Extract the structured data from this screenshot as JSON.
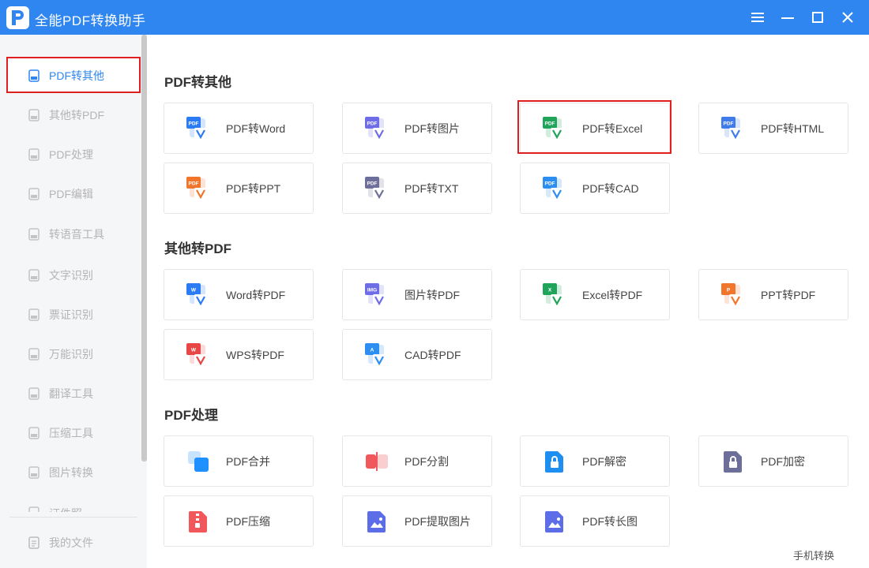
{
  "app": {
    "title": "全能PDF转换助手"
  },
  "sidebar": {
    "items": [
      {
        "label": "PDF转其他",
        "icon": "pdf-convert-icon",
        "active": true
      },
      {
        "label": "其他转PDF",
        "icon": "to-pdf-icon"
      },
      {
        "label": "PDF处理",
        "icon": "pdf-process-icon"
      },
      {
        "label": "PDF编辑",
        "icon": "pdf-edit-icon"
      },
      {
        "label": "转语音工具",
        "icon": "voice-icon"
      },
      {
        "label": "文字识别",
        "icon": "ocr-icon"
      },
      {
        "label": "票证识别",
        "icon": "ticket-icon"
      },
      {
        "label": "万能识别",
        "icon": "scan-icon"
      },
      {
        "label": "翻译工具",
        "icon": "translate-icon"
      },
      {
        "label": "压缩工具",
        "icon": "compress-icon"
      },
      {
        "label": "图片转换",
        "icon": "image-convert-icon"
      },
      {
        "label": "证件照",
        "icon": "id-photo-icon"
      }
    ],
    "my_files": "我的文件"
  },
  "sections": [
    {
      "title": "PDF转其他",
      "tools": [
        {
          "label": "PDF转Word",
          "icon": "pdf-to-word-icon",
          "color": "#2b7cf4"
        },
        {
          "label": "PDF转图片",
          "icon": "pdf-to-image-icon",
          "color": "#6f6ce8"
        },
        {
          "label": "PDF转Excel",
          "icon": "pdf-to-excel-icon",
          "color": "#1fa45a",
          "highlighted": true
        },
        {
          "label": "PDF转HTML",
          "icon": "pdf-to-html-icon",
          "color": "#3f7bea"
        },
        {
          "label": "PDF转PPT",
          "icon": "pdf-to-ppt-icon",
          "color": "#f2752c"
        },
        {
          "label": "PDF转TXT",
          "icon": "pdf-to-txt-icon",
          "color": "#6d6f9a"
        },
        {
          "label": "PDF转CAD",
          "icon": "pdf-to-cad-icon",
          "color": "#2c8ef0"
        }
      ]
    },
    {
      "title": "其他转PDF",
      "tools": [
        {
          "label": "Word转PDF",
          "icon": "word-to-pdf-icon",
          "color": "#2b7cf4"
        },
        {
          "label": "图片转PDF",
          "icon": "image-to-pdf-icon",
          "color": "#6f6ce8"
        },
        {
          "label": "Excel转PDF",
          "icon": "excel-to-pdf-icon",
          "color": "#1fa45a"
        },
        {
          "label": "PPT转PDF",
          "icon": "ppt-to-pdf-icon",
          "color": "#f2752c"
        },
        {
          "label": "WPS转PDF",
          "icon": "wps-to-pdf-icon",
          "color": "#e84545"
        },
        {
          "label": "CAD转PDF",
          "icon": "cad-to-pdf-icon",
          "color": "#2c8ef0"
        }
      ]
    },
    {
      "title": "PDF处理",
      "tools": [
        {
          "label": "PDF合并",
          "icon": "pdf-merge-icon",
          "color": "#1e90ff"
        },
        {
          "label": "PDF分割",
          "icon": "pdf-split-icon",
          "color": "#f0585c"
        },
        {
          "label": "PDF解密",
          "icon": "pdf-decrypt-icon",
          "color": "#1e8ff0"
        },
        {
          "label": "PDF加密",
          "icon": "pdf-encrypt-icon",
          "color": "#6d6f9a"
        },
        {
          "label": "PDF压缩",
          "icon": "pdf-compress-icon",
          "color": "#f0585c"
        },
        {
          "label": "PDF提取图片",
          "icon": "pdf-extract-image-icon",
          "color": "#5b6ee8"
        },
        {
          "label": "PDF转长图",
          "icon": "pdf-to-long-image-icon",
          "color": "#5b6ee8"
        }
      ]
    }
  ],
  "footer": {
    "mobile_link": "手机转换"
  }
}
